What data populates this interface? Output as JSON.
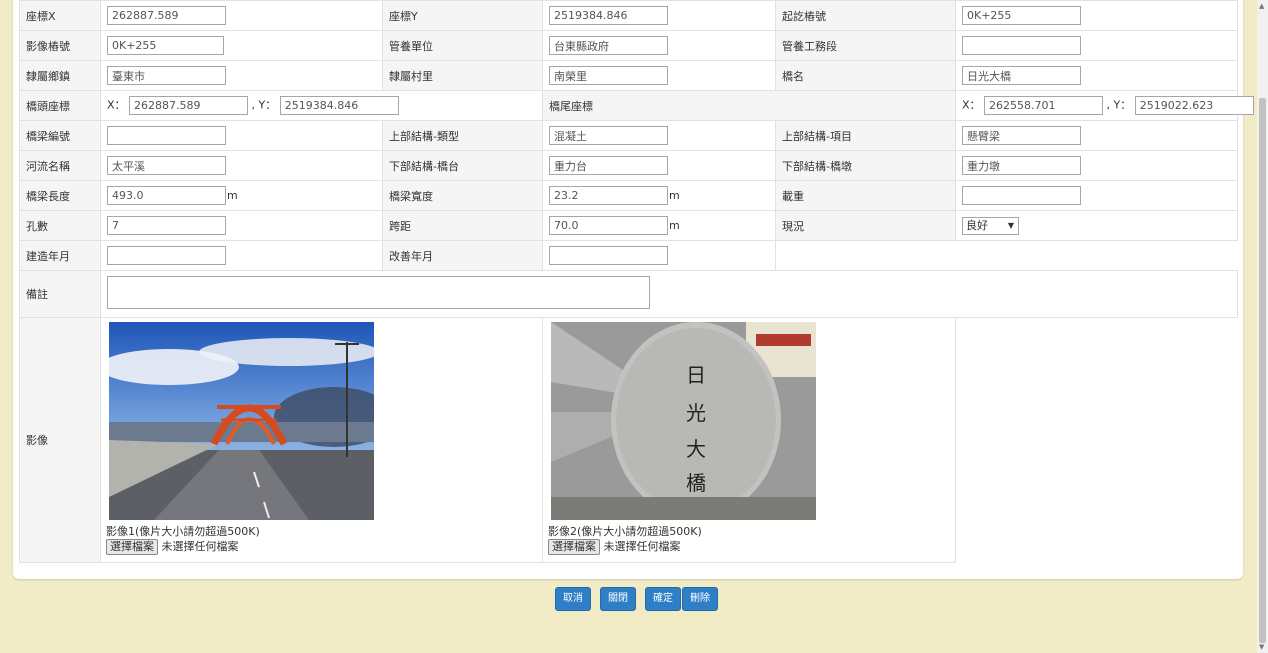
{
  "labels": {
    "coord_x": "座標X",
    "coord_y": "座標Y",
    "start_mileage": "起訖樁號",
    "image_mileage": "影像樁號",
    "mgmt_unit": "管養單位",
    "mgmt_section": "管養工務段",
    "township": "隸屬鄉鎮",
    "village": "隸屬村里",
    "bridge_name": "橋名",
    "head_coord": "橋頭座標",
    "tail_coord": "橋尾座標",
    "bridge_no": "橋梁編號",
    "super_type": "上部結構-類型",
    "super_item": "上部結構-項目",
    "river": "河流名稱",
    "sub_abutment": "下部結構-橋台",
    "sub_pier": "下部結構-橋墩",
    "length": "橋梁長度",
    "width": "橋梁寬度",
    "load": "載重",
    "spans": "孔數",
    "span_length": "跨距",
    "status": "現況",
    "built": "建造年月",
    "rebuilt": "改善年月",
    "remark": "備註",
    "images": "影像",
    "x_prefix": "X：",
    "y_prefix": ", Y：",
    "unit_m": "m"
  },
  "values": {
    "coord_x": "262887.589",
    "coord_y": "2519384.846",
    "start_mileage": "0K+255",
    "image_mileage": "0K+255",
    "mgmt_unit": "台東縣政府",
    "mgmt_section": "",
    "township": "臺東市",
    "village": "南榮里",
    "bridge_name": "日光大橋",
    "head_x": "262887.589",
    "head_y": "2519384.846",
    "tail_x": "262558.701",
    "tail_y": "2519022.623",
    "bridge_no": "",
    "super_type": "混凝土",
    "super_item": "懸臂梁",
    "river": "太平溪",
    "sub_abutment": "重力台",
    "sub_pier": "重力墩",
    "length": "493.0",
    "width": "23.2",
    "load": "",
    "spans": "7",
    "span_length": "70.0",
    "status": "良好",
    "built": "",
    "rebuilt": "",
    "remark": ""
  },
  "images": [
    {
      "caption": "影像1(像片大小請勿超過500K)",
      "file_button": "選擇檔案",
      "file_status": "未選擇任何檔案"
    },
    {
      "caption": "影像2(像片大小請勿超過500K)",
      "file_button": "選擇檔案",
      "file_status": "未選擇任何檔案",
      "stone_text": "日光大橋"
    }
  ],
  "buttons": {
    "cancel": "取消",
    "close": "關閉",
    "confirm": "確定",
    "delete": "刪除"
  },
  "colors": {
    "background": "#f1ecc6",
    "button": "#2e7fc6"
  }
}
